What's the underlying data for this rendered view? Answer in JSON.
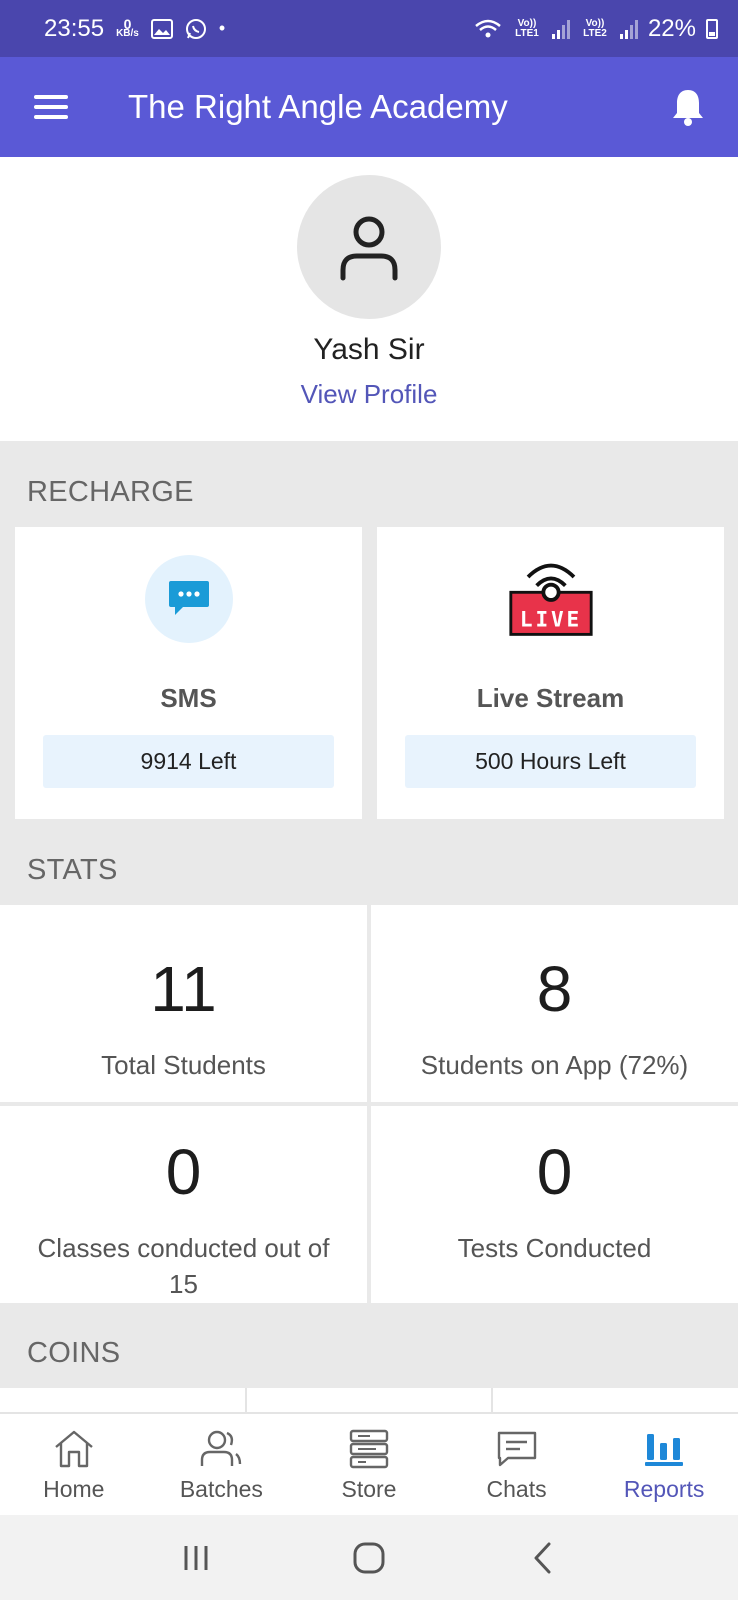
{
  "status_bar": {
    "time": "23:55",
    "speed_value": "0",
    "speed_unit": "KB/s",
    "signal1_label": "Vo)) LTE1",
    "signal2_label": "Vo)) LTE2",
    "battery": "22%"
  },
  "app_bar": {
    "title": "The Right Angle Academy"
  },
  "profile": {
    "name": "Yash Sir",
    "view_profile": "View Profile"
  },
  "recharge": {
    "section_label": "RECHARGE",
    "cards": [
      {
        "title": "SMS",
        "remaining": "9914 Left",
        "icon": "sms-bubble-icon"
      },
      {
        "title": "Live Stream",
        "remaining": "500 Hours Left",
        "icon": "live-stream-icon",
        "badge": "LIVE"
      }
    ]
  },
  "stats": {
    "section_label": "STATS",
    "items": [
      {
        "value": "11",
        "label": "Total Students"
      },
      {
        "value": "8",
        "label": "Students on App (72%)"
      },
      {
        "value": "0",
        "label": "Classes conducted out of 15"
      },
      {
        "value": "0",
        "label": "Tests Conducted"
      }
    ]
  },
  "coins": {
    "section_label": "COINS"
  },
  "bottom_nav": {
    "items": [
      {
        "label": "Home",
        "icon": "home-icon"
      },
      {
        "label": "Batches",
        "icon": "batches-icon"
      },
      {
        "label": "Store",
        "icon": "store-icon"
      },
      {
        "label": "Chats",
        "icon": "chats-icon"
      },
      {
        "label": "Reports",
        "icon": "reports-icon",
        "active": true
      }
    ]
  },
  "colors": {
    "status_bar": "#4a46ad",
    "app_bar": "#5a59d6",
    "accent": "#5356b8",
    "live_red": "#e8334a",
    "sms_blue": "#1a9bd7"
  }
}
